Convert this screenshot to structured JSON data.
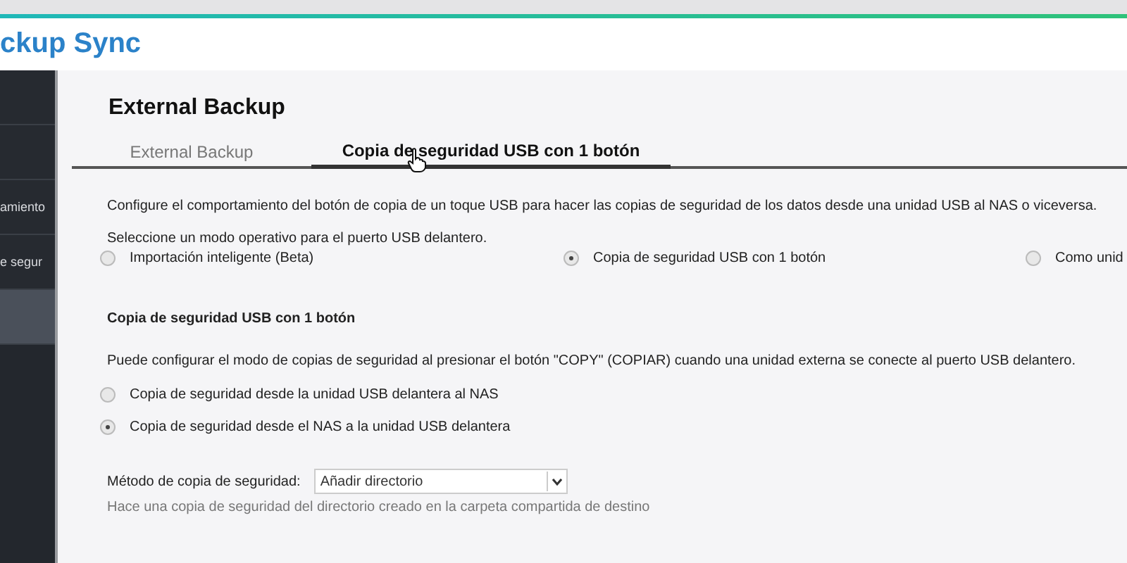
{
  "app_title": "ckup Sync",
  "sidebar": {
    "items": [
      {
        "selected": false
      },
      {
        "selected": false
      },
      {
        "label": "amiento",
        "selected": false
      },
      {
        "label": "e segur",
        "selected": false
      },
      {
        "selected": true
      }
    ]
  },
  "page_title": "External Backup",
  "tabs": [
    {
      "label": "External Backup",
      "selected": false
    },
    {
      "label": "Copia de seguridad USB con 1 botón",
      "selected": true
    }
  ],
  "description": "Configure el comportamiento del botón de copia de un toque USB para hacer las copias de seguridad de los datos desde una unidad USB al NAS o viceversa.",
  "mode_prompt": "Seleccione un modo operativo para el puerto USB delantero.",
  "modes": [
    {
      "label": "Importación inteligente (Beta)",
      "selected": false
    },
    {
      "label": "Copia de seguridad USB con 1 botón",
      "selected": true
    },
    {
      "label": "Como unid",
      "selected": false
    }
  ],
  "section_title": "Copia de seguridad USB con 1 botón",
  "section_description": "Puede configurar el modo de copias de seguridad al presionar el botón \"COPY\" (COPIAR) cuando una unidad externa se conecte al puerto USB delantero.",
  "directions": [
    {
      "label": "Copia de seguridad desde la unidad USB delantera al NAS",
      "selected": false
    },
    {
      "label": "Copia de seguridad desde el NAS a la unidad USB delantera",
      "selected": true
    }
  ],
  "method": {
    "label": "Método de copia de seguridad:",
    "value": "Añadir directorio",
    "hint": "Hace una copia de seguridad del directorio creado en la carpeta compartida de destino"
  }
}
